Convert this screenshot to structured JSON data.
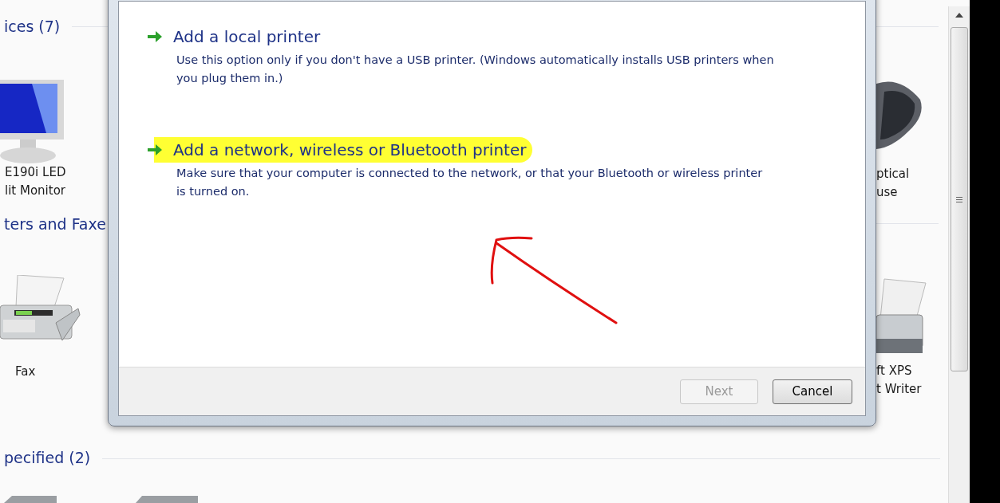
{
  "background": {
    "groups": [
      {
        "title": "ices (7)"
      },
      {
        "title": "ters and Faxe"
      },
      {
        "title": "pecified (2)"
      }
    ],
    "devices": [
      {
        "kind": "monitor",
        "lines": [
          "E190i LED",
          "lit Monitor"
        ]
      },
      {
        "kind": "fax",
        "lines": [
          "Fax"
        ]
      },
      {
        "kind": "mouse",
        "lines": [
          "ptical",
          "use"
        ]
      },
      {
        "kind": "printer",
        "lines": [
          "ft XPS",
          "t Writer"
        ]
      }
    ]
  },
  "dialog": {
    "options": [
      {
        "title": "Add a local printer",
        "description": "Use this option only if you don't have a USB printer. (Windows automatically installs USB printers when you plug them in.)",
        "highlighted": false
      },
      {
        "title": "Add a network, wireless or Bluetooth printer",
        "description": "Make sure that your computer is connected to the network, or that your Bluetooth or wireless printer is turned on.",
        "highlighted": true
      }
    ],
    "buttons": [
      {
        "label": "Next",
        "disabled": true
      },
      {
        "label": "Cancel",
        "disabled": false
      }
    ]
  }
}
